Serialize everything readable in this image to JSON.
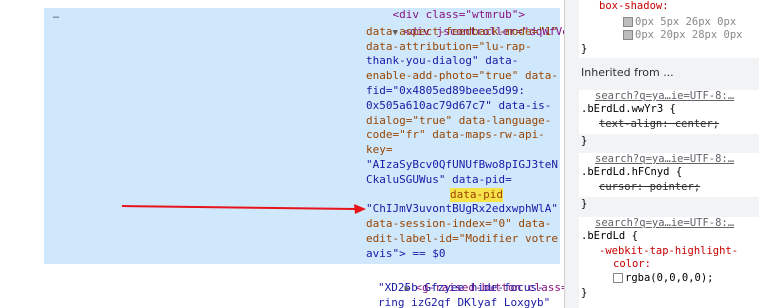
{
  "elements_panel": {
    "top_partial": "<div class=\"wtmrub\">",
    "ellipsis": "…",
    "lines": [
      [
        "▼ ",
        "<div jscontroller=\"dqWfVe\""
      ],
      [
        "",
        "data-aspect-feedback-mode=\"1\""
      ],
      [
        "",
        "data-attribution=\"lu-rap-"
      ],
      [
        "",
        "thank-you-dialog\" data-"
      ],
      [
        "",
        "enable-add-photo=\"true\" data-"
      ],
      [
        "",
        "fid=\"0x4805ed89beee5d99:"
      ],
      [
        "",
        "0x505a610ac79d67c7\" data-is-"
      ],
      [
        "",
        "dialog=\"true\" data-language-"
      ],
      [
        "",
        "code=\"fr\" data-maps-rw-api-"
      ],
      [
        "",
        "key="
      ],
      [
        "",
        "\"AIzaSyBcv0QfUNUfBwo8pIGJ3teN"
      ],
      [
        "",
        "CkaluSGUWus\" data-pid="
      ],
      [
        "",
        "\"ChIJmV3uvontBUgRx2edxwphWlA\""
      ],
      [
        "",
        "data-session-index=\"0\" data-"
      ],
      [
        "",
        "edit-label-id=\"Modifier votre"
      ],
      [
        "",
        "avis\"> == $0"
      ],
      [
        "▶ ",
        "<g-raised-button class="
      ],
      [
        "",
        "\"XD25b Gfzyee hide-focus-"
      ],
      [
        "",
        "ring izG2qf DKlyaf Loxgyb\""
      ]
    ],
    "highlight_text": "data-pid"
  },
  "styles_panel": {
    "box_shadow_label": "box-shadow:",
    "box_shadow_line1": "0px 5px 26px 0px",
    "box_shadow_line2": "0px 20px 28px 0px",
    "brace_close": "}",
    "inherited_from": "Inherited from ...",
    "rules": [
      {
        "source": "search?q=ya…ie=UTF-8:…",
        "selector": ".bErdLd.wwYr3 {",
        "prop": "text-align: center;"
      },
      {
        "source": "search?q=ya…ie=UTF-8:…",
        "selector": ".bErdLd.hFCnyd {",
        "prop": "cursor: pointer;"
      },
      {
        "source": "search?q=ya…ie=UTF-8:…",
        "selector": ".bErdLd {",
        "prop_name": "-webkit-tap-highlight-",
        "prop_name2": "color:",
        "prop_value": "rgba(0,0,0,0);"
      }
    ]
  },
  "annotation": {
    "arrow_color": "#e8141b"
  }
}
